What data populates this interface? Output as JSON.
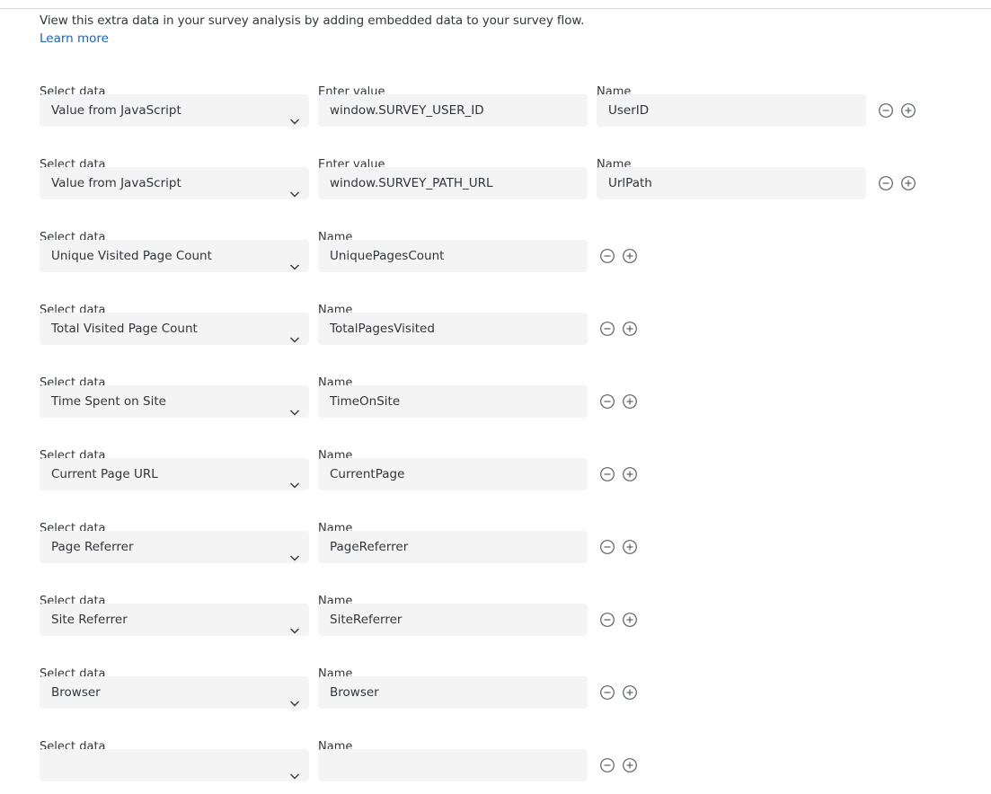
{
  "intro": {
    "text": "View this extra data in your survey analysis by adding embedded data to your survey flow.",
    "learn_more": "Learn more"
  },
  "labels": {
    "select_data": "Select data",
    "enter_value": "Enter value",
    "name": "Name"
  },
  "icons": {
    "remove": "minus-circle-icon",
    "add": "plus-circle-icon",
    "dropdown": "chevron-down-icon"
  },
  "rows": [
    {
      "select": "Value from JavaScript",
      "value": "window.SURVEY_USER_ID",
      "name": "UserID"
    },
    {
      "select": "Value from JavaScript",
      "value": "window.SURVEY_PATH_URL",
      "name": "UrlPath"
    },
    {
      "select": "Unique Visited Page Count",
      "name": "UniquePagesCount"
    },
    {
      "select": "Total Visited Page Count",
      "name": "TotalPagesVisited"
    },
    {
      "select": "Time Spent on Site",
      "name": "TimeOnSite"
    },
    {
      "select": "Current Page URL",
      "name": "CurrentPage"
    },
    {
      "select": "Page Referrer",
      "name": "PageReferrer"
    },
    {
      "select": "Site Referrer",
      "name": "SiteReferrer"
    },
    {
      "select": "Browser",
      "name": "Browser"
    },
    {
      "select": "",
      "name": ""
    }
  ]
}
